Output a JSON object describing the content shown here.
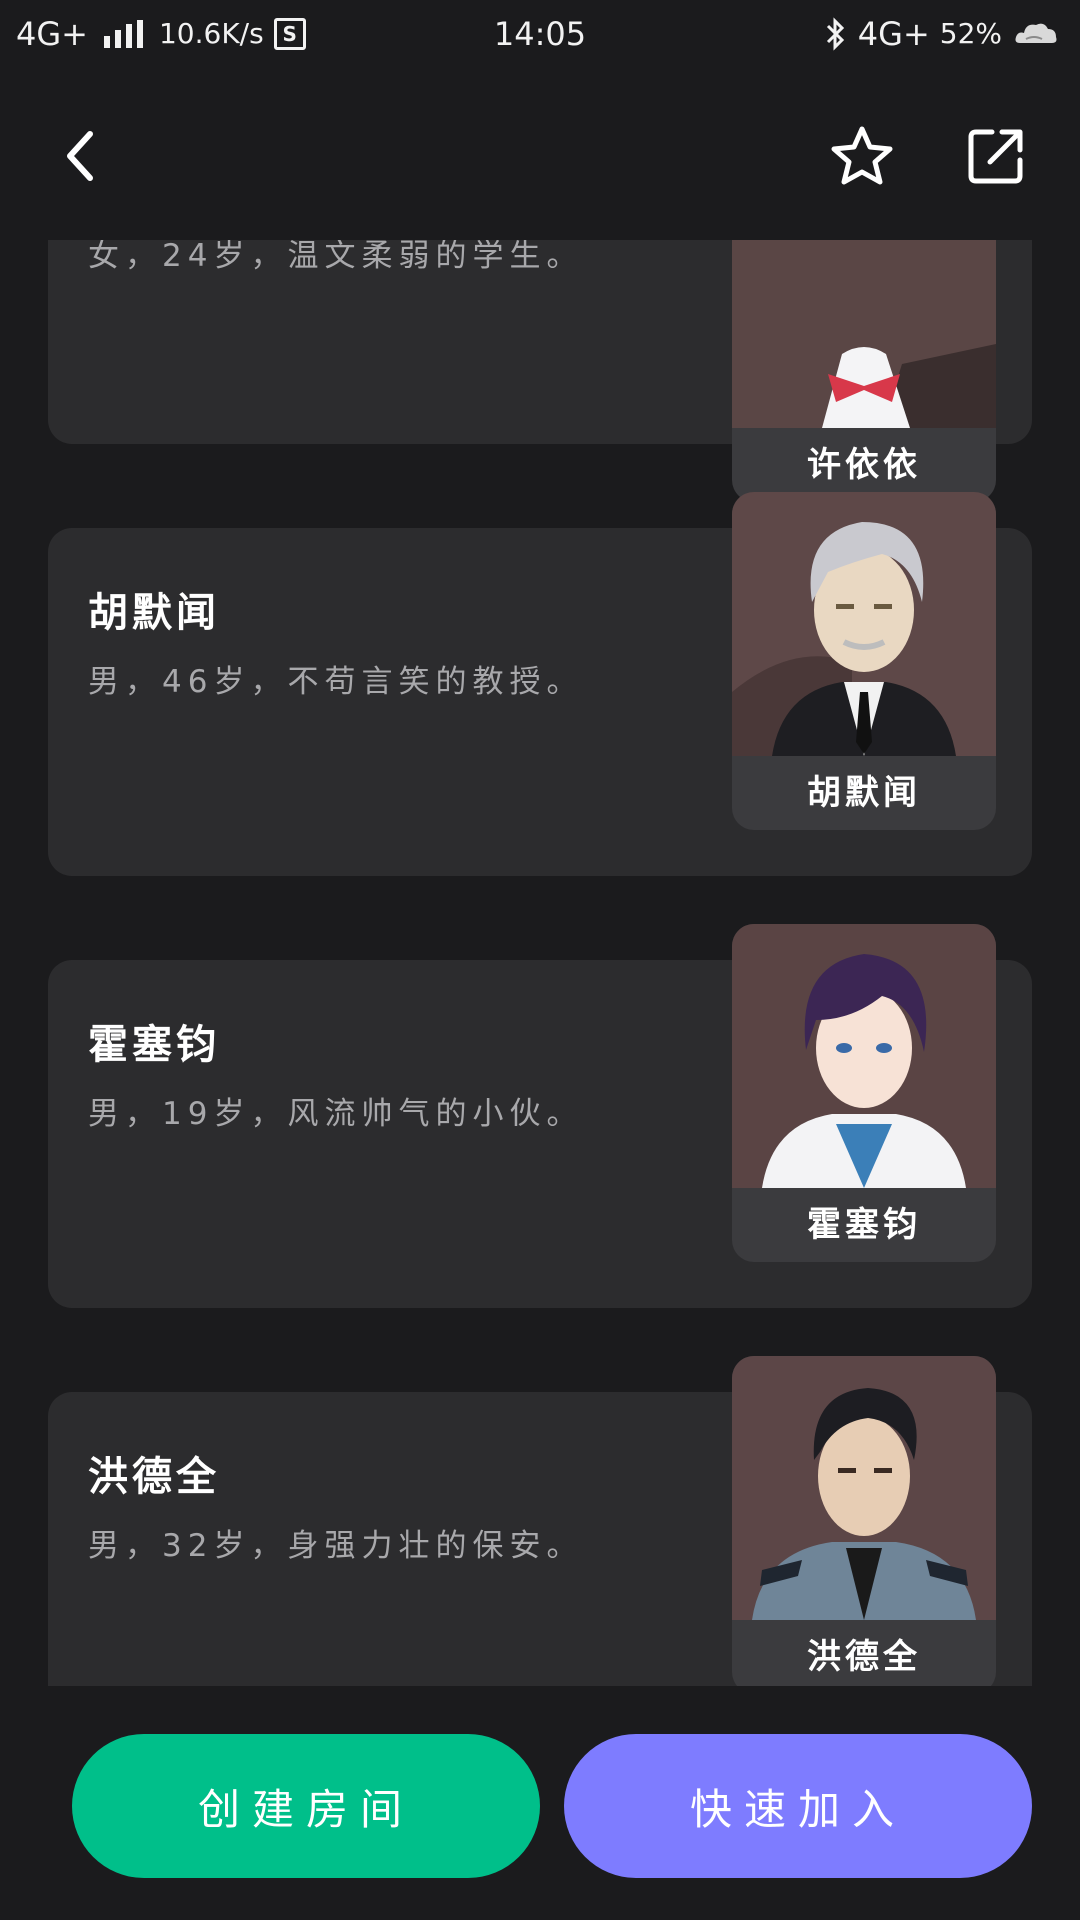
{
  "status_bar": {
    "network_left": "4G+",
    "speed": "10.6K/s",
    "s_badge": "S",
    "time": "14:05",
    "network_right": "4G+",
    "battery": "52%"
  },
  "header": {
    "back_icon": "chevron-left-icon",
    "favorite_icon": "star-outline-icon",
    "share_icon": "share-external-icon"
  },
  "characters": [
    {
      "name": "许依依",
      "desc_visible": "女，24岁，温文柔弱的学生。",
      "avatar_label": "许依依"
    },
    {
      "name": "胡默闻",
      "desc": "男，46岁，不苟言笑的教授。",
      "avatar_label": "胡默闻"
    },
    {
      "name": "霍塞钧",
      "desc": "男，19岁，风流帅气的小伙。",
      "avatar_label": "霍塞钧"
    },
    {
      "name": "洪德全",
      "desc": "男，32岁，身强力壮的保安。",
      "avatar_label": "洪德全"
    }
  ],
  "buttons": {
    "create_room": "创建房间",
    "quick_join": "快速加入"
  },
  "colors": {
    "background": "#1b1b1d",
    "card": "#2c2c2e",
    "create_button": "#00bf8a",
    "join_button": "#7e7cff"
  }
}
